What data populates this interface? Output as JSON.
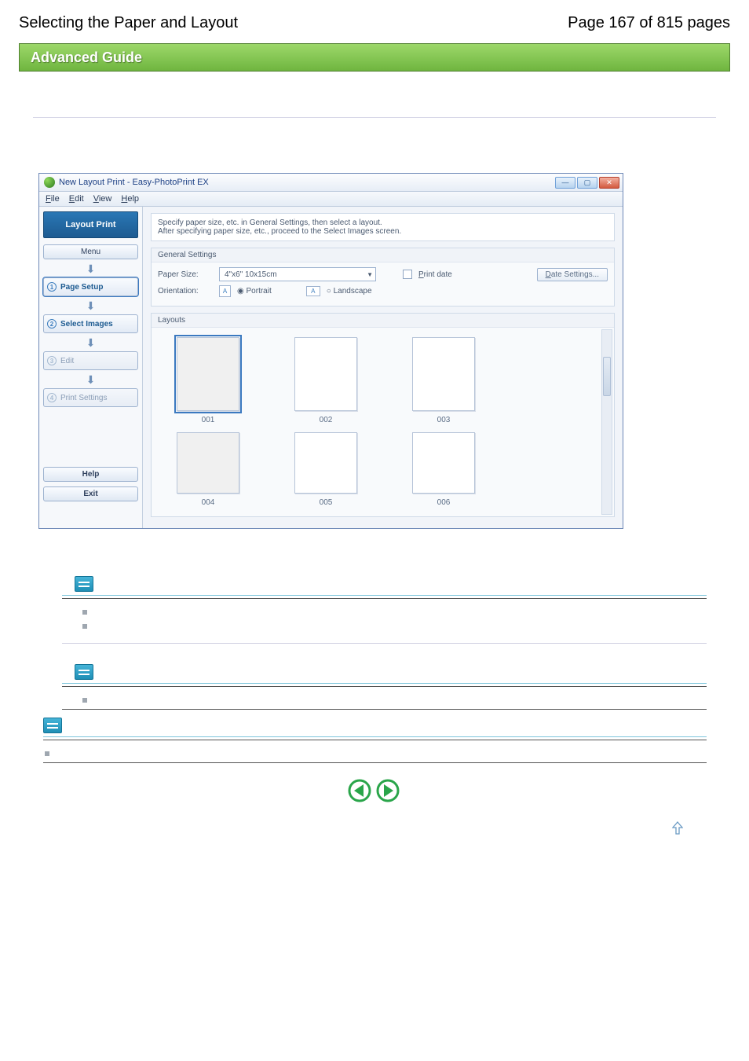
{
  "header": {
    "doc_title": "Selecting the Paper and Layout",
    "page_indicator": "Page 167 of 815 pages"
  },
  "adv_banner": "Advanced Guide",
  "screenshot": {
    "window_title": "New Layout Print - Easy-PhotoPrint EX",
    "menus": {
      "file": "File",
      "edit": "Edit",
      "view": "View",
      "help": "Help"
    },
    "sidebar": {
      "header": "Layout Print",
      "menu_btn": "Menu",
      "steps": {
        "s1": "Page Setup",
        "s2": "Select Images",
        "s3": "Edit",
        "s4": "Print Settings"
      },
      "help_btn": "Help",
      "exit_btn": "Exit"
    },
    "instruction": {
      "line1": "Specify paper size, etc. in General Settings, then select a layout.",
      "line2": "After specifying paper size, etc., proceed to the Select Images screen."
    },
    "general": {
      "title": "General Settings",
      "paper_label": "Paper Size:",
      "paper_value": "4\"x6\" 10x15cm",
      "orient_label": "Orientation:",
      "portrait": "Portrait",
      "landscape": "Landscape",
      "print_date": "Print date",
      "date_settings_btn": "Date Settings..."
    },
    "layouts": {
      "title": "Layouts",
      "t1": "001",
      "t2": "002",
      "t3": "003",
      "t4": "004",
      "t5": "005",
      "t6": "006"
    }
  }
}
